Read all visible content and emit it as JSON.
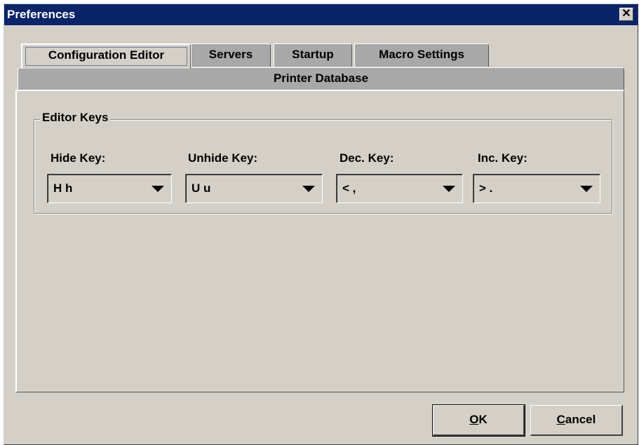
{
  "window": {
    "title": "Preferences"
  },
  "tabs": {
    "row1": [
      {
        "label": "Configuration Editor",
        "active": true
      },
      {
        "label": "Servers",
        "active": false
      },
      {
        "label": "Startup",
        "active": false
      },
      {
        "label": "Macro Settings",
        "active": false
      }
    ],
    "row2": [
      {
        "label": "Printer Database",
        "active": false
      }
    ]
  },
  "editor_keys": {
    "group_title": "Editor Keys",
    "fields": [
      {
        "label": "Hide Key:",
        "value": "H h"
      },
      {
        "label": "Unhide Key:",
        "value": "U u"
      },
      {
        "label": "Dec. Key:",
        "value": "< ,"
      },
      {
        "label": "Inc. Key:",
        "value": "> ."
      }
    ]
  },
  "buttons": {
    "ok_mnemonic": "O",
    "ok_rest": "K",
    "cancel_mnemonic": "C",
    "cancel_rest": "ancel"
  }
}
